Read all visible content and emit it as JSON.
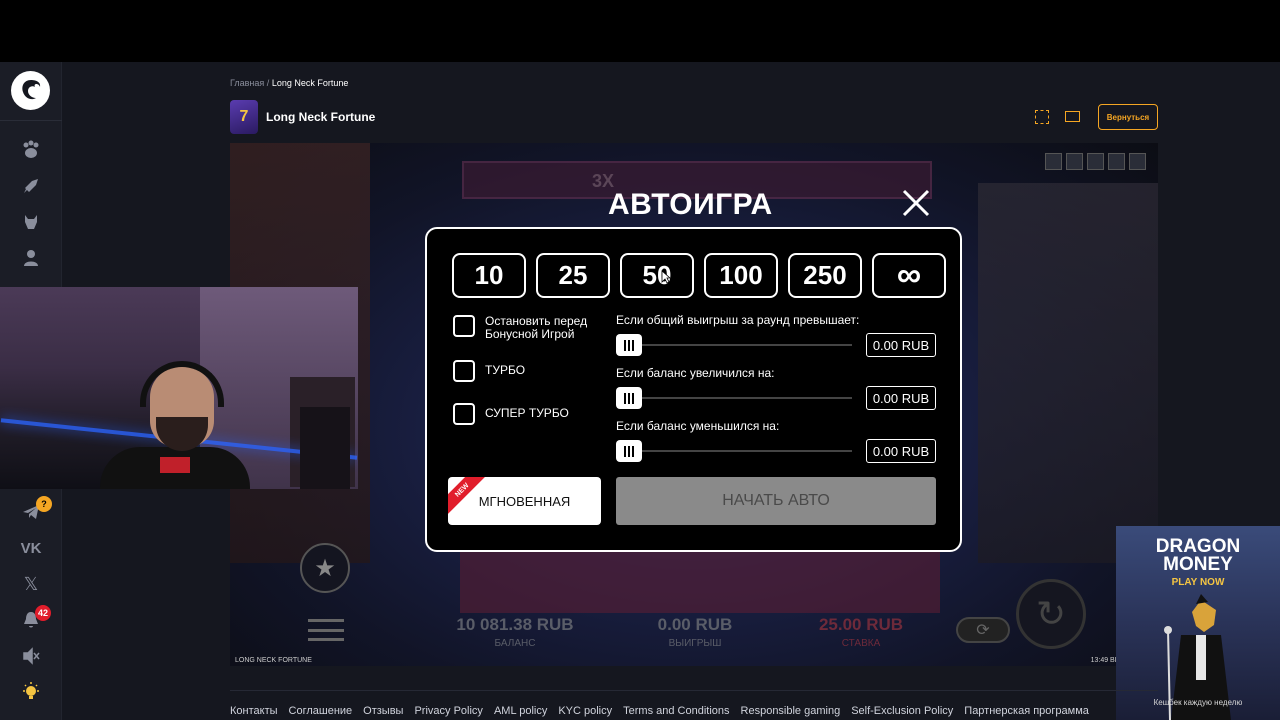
{
  "breadcrumb": {
    "home": "Главная",
    "sep": "/",
    "current": "Long Neck Fortune"
  },
  "game": {
    "title": "Long Neck Fortune",
    "back_label": "Вернуться",
    "footer_left": "LONG NECK FORTUNE",
    "footer_right": "13:49  BELATRA © 2",
    "balance": "10 081.38 RUB",
    "balance_label": "БАЛАНС",
    "win": "0.00 RUB",
    "win_label": "ВЫИГРЫШ",
    "bet": "25.00 RUB",
    "bet_label": "СТАВКА",
    "multiplier": "3X"
  },
  "autoplay": {
    "title": "АВТОИГРА",
    "counts": [
      "10",
      "25",
      "50",
      "100",
      "250",
      "∞"
    ],
    "options": [
      {
        "label": "Остановить перед Бонусной Игрой"
      },
      {
        "label": "ТУРБО"
      },
      {
        "label": "СУПЕР ТУРБО"
      }
    ],
    "conditions": [
      {
        "label": "Если общий выигрыш за раунд превышает:",
        "value": "0.00 RUB",
        "level": 0
      },
      {
        "label": "Если баланс увеличился на:",
        "value": "0.00 RUB",
        "level": 0
      },
      {
        "label": "Если баланс уменьшился на:",
        "value": "0.00 RUB",
        "level": 0
      }
    ],
    "instant_label": "МГНОВЕННАЯ",
    "new_badge": "NEW",
    "start_label": "НАЧАТЬ АВТО"
  },
  "sidebar": {
    "badges": {
      "help": "?",
      "notifications": "42"
    }
  },
  "promo": {
    "line1": "DRAGON",
    "line2": "MONEY",
    "cta": "PLAY NOW",
    "caption": "Кешбек каждую неделю"
  },
  "footer": {
    "links": [
      "Контакты",
      "Соглашение",
      "Отзывы",
      "Privacy Policy",
      "AML policy",
      "KYC policy",
      "Terms and Conditions",
      "Responsible gaming",
      "Self-Exclusion Policy",
      "Партнерская программа"
    ]
  },
  "colors": {
    "accent": "#f5a623",
    "new_badge": "#e11d2b",
    "background": "#15171f"
  }
}
